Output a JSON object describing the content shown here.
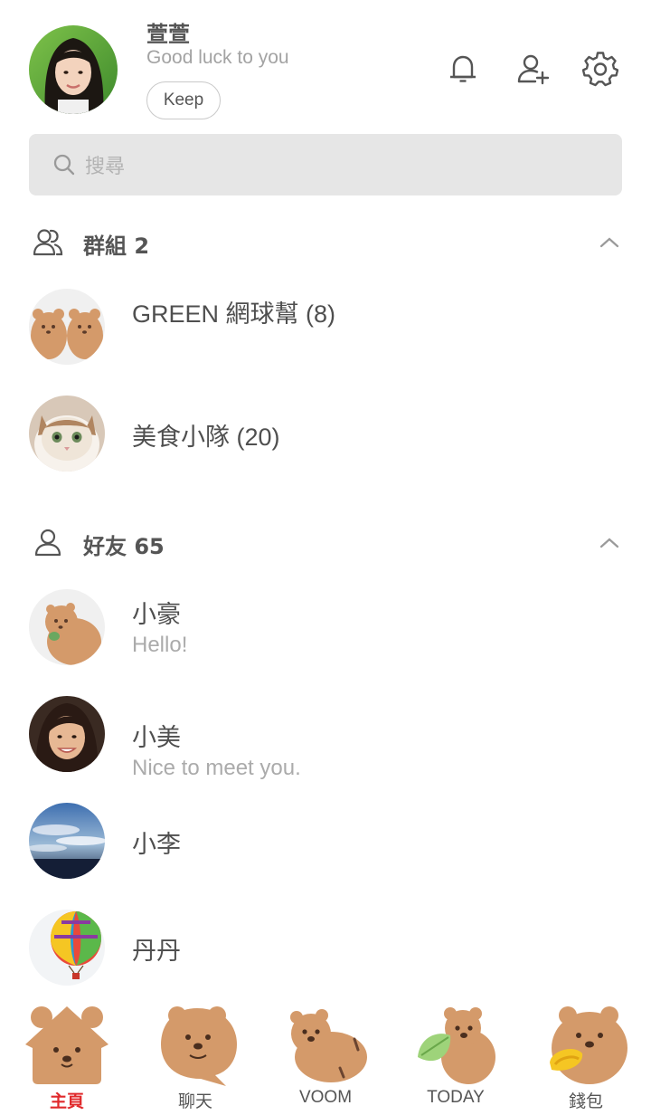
{
  "profile": {
    "name": "萱萱",
    "status": "Good luck to you",
    "keep_label": "Keep"
  },
  "header_icons": [
    "bell-icon",
    "add-friend-icon",
    "settings-gear-icon"
  ],
  "search": {
    "placeholder": "搜尋"
  },
  "groups_section": {
    "title": "群組 2",
    "items": [
      {
        "name": "GREEN 網球幫 (8)"
      },
      {
        "name": "美食小隊 (20)"
      }
    ]
  },
  "friends_section": {
    "title": "好友 65",
    "items": [
      {
        "name": "小豪",
        "status": "Hello!"
      },
      {
        "name": "小美",
        "status": "Nice to meet you."
      },
      {
        "name": "小李"
      },
      {
        "name": "丹丹"
      }
    ]
  },
  "bottom_nav": {
    "items": [
      {
        "label": "主頁",
        "active": true
      },
      {
        "label": "聊天"
      },
      {
        "label": "VOOM"
      },
      {
        "label": "TODAY"
      },
      {
        "label": "錢包"
      }
    ]
  },
  "colors": {
    "accent_active": "#e0292b",
    "search_bg": "#e6e6e6",
    "bear_brown": "#d49a6a"
  }
}
